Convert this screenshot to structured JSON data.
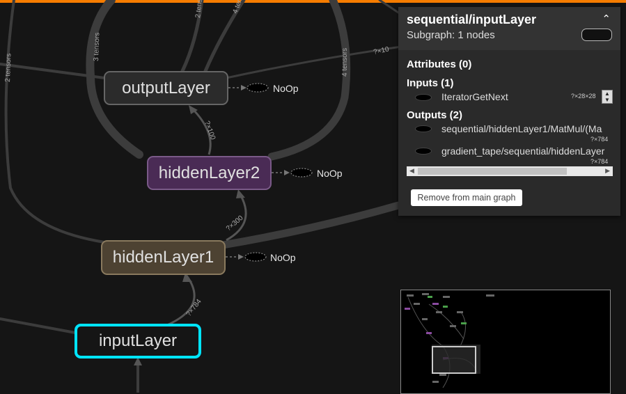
{
  "graph": {
    "nodes": {
      "output": "outputLayer",
      "hidden2": "hiddenLayer2",
      "hidden1": "hiddenLayer1",
      "input": "inputLayer"
    },
    "noop_label": "NoOp",
    "edge_labels": {
      "left": "2 tensors",
      "mid": "3 tensors",
      "top1": "2 tensors",
      "top2": "4 tensors",
      "right": "4 tensors",
      "x10": "?×10",
      "h2_out": "?×100",
      "h1_h2": "?×300",
      "in_h1": "?×784"
    },
    "colors": {
      "output_fill": "#2b2b2b",
      "hidden2_fill": "#4a2b55",
      "hidden1_fill": "#4d4232",
      "input_fill": "#151515",
      "selected_border": "#00e5ff",
      "accent_bar": "#f57c00"
    }
  },
  "panel": {
    "title": "sequential/inputLayer",
    "subtitle": "Subgraph: 1 nodes",
    "collapse_icon": "chevron-up",
    "attributes_heading": "Attributes (0)",
    "inputs_heading": "Inputs (1)",
    "inputs": [
      {
        "name": "IteratorGetNext",
        "shape": "?×28×28"
      }
    ],
    "outputs_heading": "Outputs (2)",
    "outputs": [
      {
        "name": "sequential/hiddenLayer1/MatMul/(Ma",
        "shape": "?×784"
      },
      {
        "name": "gradient_tape/sequential/hiddenLayer",
        "shape": "?×784"
      }
    ],
    "remove_button": "Remove from main graph"
  }
}
